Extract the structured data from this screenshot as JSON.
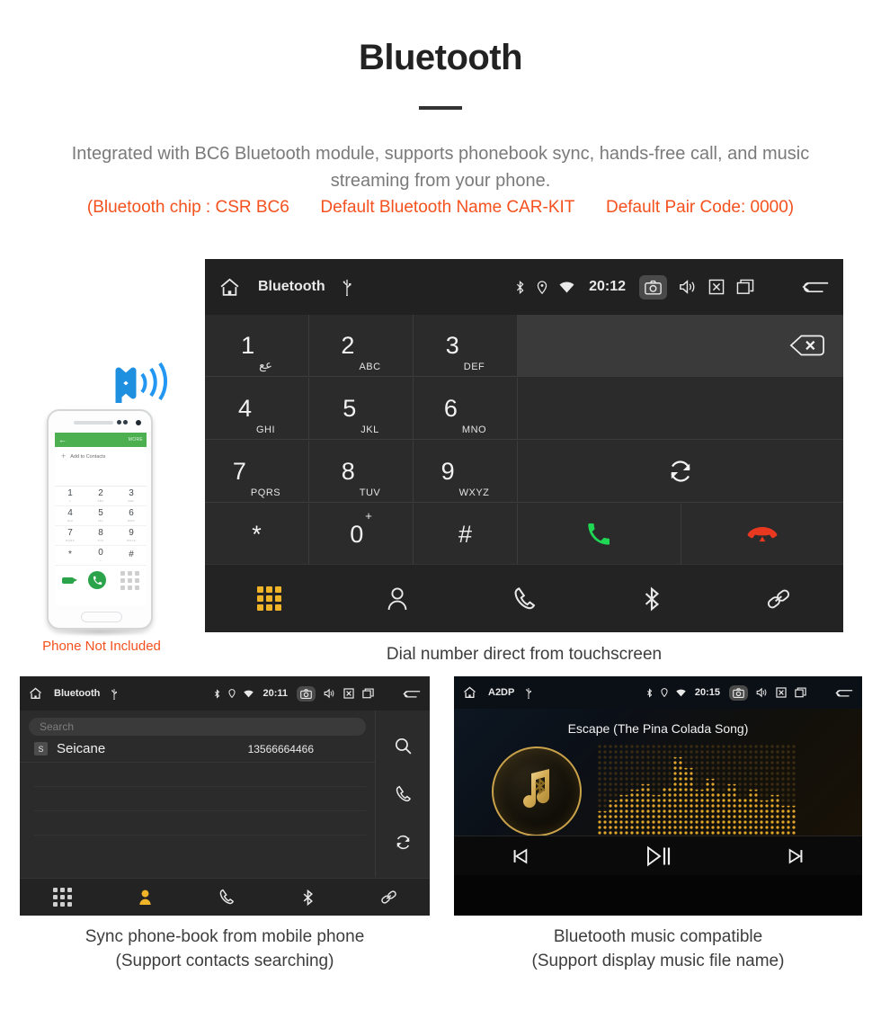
{
  "header": {
    "title": "Bluetooth",
    "description": "Integrated with BC6 Bluetooth module, supports phonebook sync, hands-free call, and music streaming from your phone.",
    "spec_chip": "(Bluetooth chip : CSR BC6",
    "spec_name": "Default Bluetooth Name CAR-KIT",
    "spec_pair": "Default Pair Code: 0000)",
    "accent_color": "#f4511e",
    "body_color": "#7a7a7a"
  },
  "dialer": {
    "statusbar": {
      "home_icon": "home-icon",
      "title": "Bluetooth",
      "usb_icon": "usb-icon",
      "bluetooth_icon": "bluetooth-icon",
      "location_icon": "location-icon",
      "wifi_icon": "wifi-icon",
      "time": "20:12",
      "camera_icon": "camera-icon",
      "volume_icon": "volume-icon",
      "close_icon": "close-box-icon",
      "recents_icon": "recents-icon",
      "back_icon": "back-icon"
    },
    "keys": [
      {
        "digit": "1",
        "letters": "عع"
      },
      {
        "digit": "2",
        "letters": "ABC"
      },
      {
        "digit": "3",
        "letters": "DEF"
      },
      {
        "digit": "4",
        "letters": "GHI"
      },
      {
        "digit": "5",
        "letters": "JKL"
      },
      {
        "digit": "6",
        "letters": "MNO"
      },
      {
        "digit": "7",
        "letters": "PQRS"
      },
      {
        "digit": "8",
        "letters": "TUV"
      },
      {
        "digit": "9",
        "letters": "WXYZ"
      },
      {
        "digit": "*",
        "letters": ""
      },
      {
        "digit": "0",
        "letters": "+"
      },
      {
        "digit": "#",
        "letters": ""
      }
    ],
    "number_value": "",
    "backspace_icon": "backspace-icon",
    "sync_icon": "sync-icon",
    "call_icon": "call-icon",
    "hangup_icon": "hangup-icon",
    "nav": [
      {
        "name": "dialpad",
        "icon": "dialpad-icon",
        "active": true
      },
      {
        "name": "contacts",
        "icon": "contact-person-icon",
        "active": false
      },
      {
        "name": "calls",
        "icon": "phone-handset-icon",
        "active": false
      },
      {
        "name": "bluetooth",
        "icon": "bluetooth-icon",
        "active": false
      },
      {
        "name": "link",
        "icon": "link-icon",
        "active": false
      }
    ],
    "active_color": "#f0b429",
    "caption": "Dial number direct from touchscreen"
  },
  "phone_mockup": {
    "appbar_back": "←",
    "appbar_more": "MORE",
    "add_label": "Add to Contacts",
    "add_plus": "+",
    "keys": [
      {
        "digit": "1",
        "letters": "∞"
      },
      {
        "digit": "2",
        "letters": "ABC"
      },
      {
        "digit": "3",
        "letters": "DEF"
      },
      {
        "digit": "4",
        "letters": "GHI"
      },
      {
        "digit": "5",
        "letters": "JKL"
      },
      {
        "digit": "6",
        "letters": "MNO"
      },
      {
        "digit": "7",
        "letters": "PQRS"
      },
      {
        "digit": "8",
        "letters": "TUV"
      },
      {
        "digit": "9",
        "letters": "WXYZ"
      },
      {
        "digit": "*",
        "letters": ""
      },
      {
        "digit": "0",
        "letters": "+"
      },
      {
        "digit": "#",
        "letters": ""
      }
    ],
    "voicemail_icon": "voicemail-icon",
    "call_icon": "call-icon",
    "keypad_icon": "keypad-icon",
    "disclaimer": "Phone Not Included",
    "bt_wave_icon": "bluetooth-wave-icon",
    "appbar_color": "#4caf50"
  },
  "phonebook": {
    "statusbar": {
      "home_icon": "home-icon",
      "title": "Bluetooth",
      "usb_icon": "usb-icon",
      "time": "20:11",
      "camera_icon": "camera-icon",
      "volume_icon": "volume-icon",
      "close_icon": "close-box-icon",
      "recents_icon": "recents-icon",
      "back_icon": "back-icon"
    },
    "search_placeholder": "Search",
    "search_value": "",
    "contacts": [
      {
        "initial": "S",
        "name": "Seicane",
        "number": "13566664466"
      }
    ],
    "side_actions": [
      {
        "name": "search",
        "icon": "search-icon"
      },
      {
        "name": "call",
        "icon": "phone-handset-icon"
      },
      {
        "name": "sync",
        "icon": "sync-icon"
      }
    ],
    "nav": [
      {
        "name": "dialpad",
        "icon": "dialpad-icon",
        "active": false
      },
      {
        "name": "contacts",
        "icon": "contact-person-icon",
        "active": true
      },
      {
        "name": "calls",
        "icon": "phone-handset-icon",
        "active": false
      },
      {
        "name": "bluetooth",
        "icon": "bluetooth-icon",
        "active": false
      },
      {
        "name": "link",
        "icon": "link-icon",
        "active": false
      }
    ],
    "caption_line1": "Sync phone-book from mobile phone",
    "caption_line2": "(Support contacts searching)"
  },
  "music": {
    "statusbar": {
      "home_icon": "home-icon",
      "title": "A2DP",
      "usb_icon": "usb-icon",
      "time": "20:15",
      "camera_icon": "camera-icon",
      "volume_icon": "volume-icon",
      "close_icon": "close-box-icon",
      "recents_icon": "recents-icon",
      "back_icon": "back-icon"
    },
    "song_title": "Escape (The Pina Colada Song)",
    "album_art_icon": "music-note-bluetooth-icon",
    "visualizer_icon": "spectrum-visualizer",
    "controls": [
      {
        "name": "previous",
        "icon": "skip-previous-icon"
      },
      {
        "name": "play-pause",
        "icon": "play-pause-icon"
      },
      {
        "name": "next",
        "icon": "skip-next-icon"
      }
    ],
    "accent_color": "#caa24a",
    "caption_line1": "Bluetooth music compatible",
    "caption_line2": "(Support display music file name)"
  }
}
